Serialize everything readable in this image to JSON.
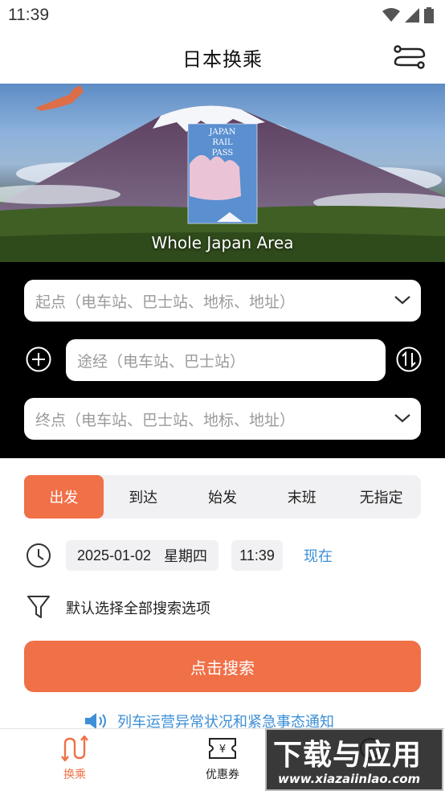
{
  "status_bar": {
    "time": "11:39",
    "icons": [
      "wifi-icon",
      "signal-icon",
      "battery-icon"
    ]
  },
  "header": {
    "title": "日本换乘",
    "menu_icon": "route-menu-icon"
  },
  "banner": {
    "caption": "Whole Japan Area",
    "pass_label": [
      "JAPAN",
      "RAIL",
      "PASS"
    ]
  },
  "search": {
    "origin_placeholder": "起点（电车站、巴士站、地标、地址）",
    "via_placeholder": "途经（电车站、巴士站）",
    "dest_placeholder": "终点（电车站、巴士站、地标、地址）"
  },
  "time_tabs": [
    {
      "label": "出发",
      "active": true
    },
    {
      "label": "到达",
      "active": false
    },
    {
      "label": "始发",
      "active": false
    },
    {
      "label": "末班",
      "active": false
    },
    {
      "label": "无指定",
      "active": false
    }
  ],
  "datetime": {
    "date": "2025-01-02",
    "weekday": "星期四",
    "time": "11:39",
    "now_label": "现在"
  },
  "filter": {
    "label": "默认选择全部搜索选项"
  },
  "search_button": {
    "label": "点击搜索"
  },
  "notice": {
    "text": "列车运营异常状况和紧急事态通知"
  },
  "bottom_nav": [
    {
      "label": "换乘",
      "icon": "transfer-icon",
      "active": true
    },
    {
      "label": "优惠券",
      "icon": "coupon-icon",
      "active": false
    },
    {
      "label": "",
      "icon": "more-icon",
      "active": false
    }
  ],
  "watermark": {
    "main": "下载与应用",
    "sub": "www.xiazaiinlao.com"
  },
  "colors": {
    "accent": "#f07048",
    "link": "#3d8fd6",
    "panel": "#000000",
    "chip_bg": "#f1f1f3"
  }
}
